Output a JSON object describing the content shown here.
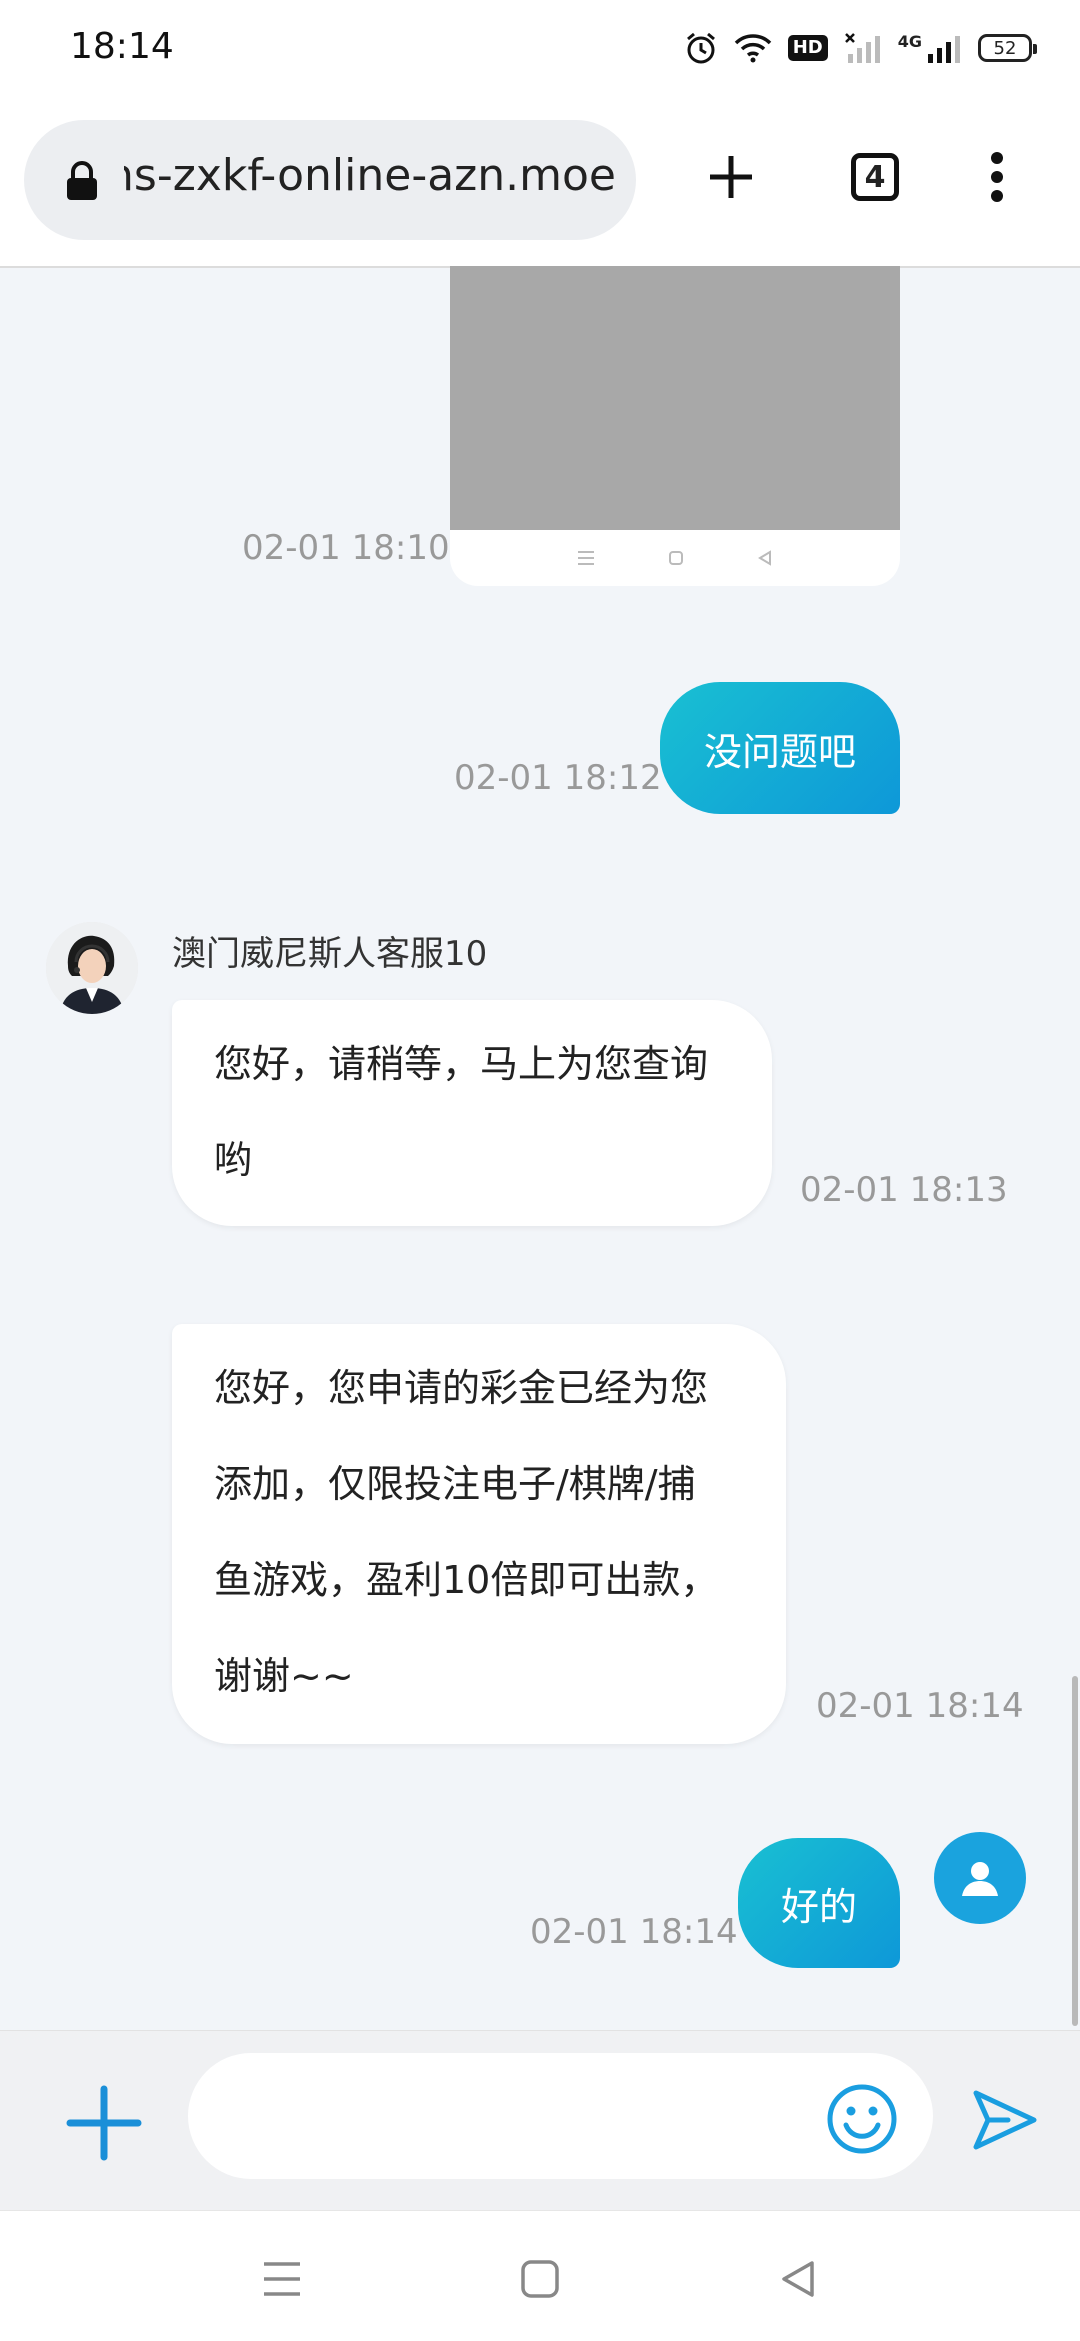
{
  "status_bar": {
    "time": "18:14",
    "hd_label": "HD",
    "network_label": "4G",
    "battery": "52"
  },
  "browser": {
    "url": "hs-zxkf-online-azn.moe",
    "tab_count": "4"
  },
  "chat": {
    "agent_name": "澳门威尼斯人客服10",
    "messages": [
      {
        "type": "image",
        "from": "me",
        "time": "02-01 18:10"
      },
      {
        "type": "text",
        "from": "me",
        "text": "没问题吧",
        "time": "02-01 18:12"
      },
      {
        "type": "text",
        "from": "agent",
        "lines": [
          "您好，请稍等，马上为您查询",
          "哟"
        ],
        "time": "02-01 18:13"
      },
      {
        "type": "text",
        "from": "agent",
        "lines": [
          "您好，您申请的彩金已经为您",
          "添加，仅限投注电子/棋牌/捕",
          "鱼游戏，盈利10倍即可出款，",
          "谢谢~~"
        ],
        "time": "02-01 18:14"
      },
      {
        "type": "text",
        "from": "me",
        "text": "好的",
        "time": "02-01 18:14"
      }
    ]
  },
  "input": {
    "value": "",
    "placeholder": ""
  },
  "icons": {
    "lock": "lock-icon",
    "new_tab": "plus-icon",
    "menu": "more-vert-icon",
    "add": "plus-icon",
    "emoji": "smiley-icon",
    "send": "send-icon",
    "user": "person-icon"
  },
  "colors": {
    "accent": "#1aa3de",
    "bubble_gradient_start": "#19c0d2",
    "bubble_gradient_end": "#0e98d8",
    "background": "#f2f5f9"
  }
}
